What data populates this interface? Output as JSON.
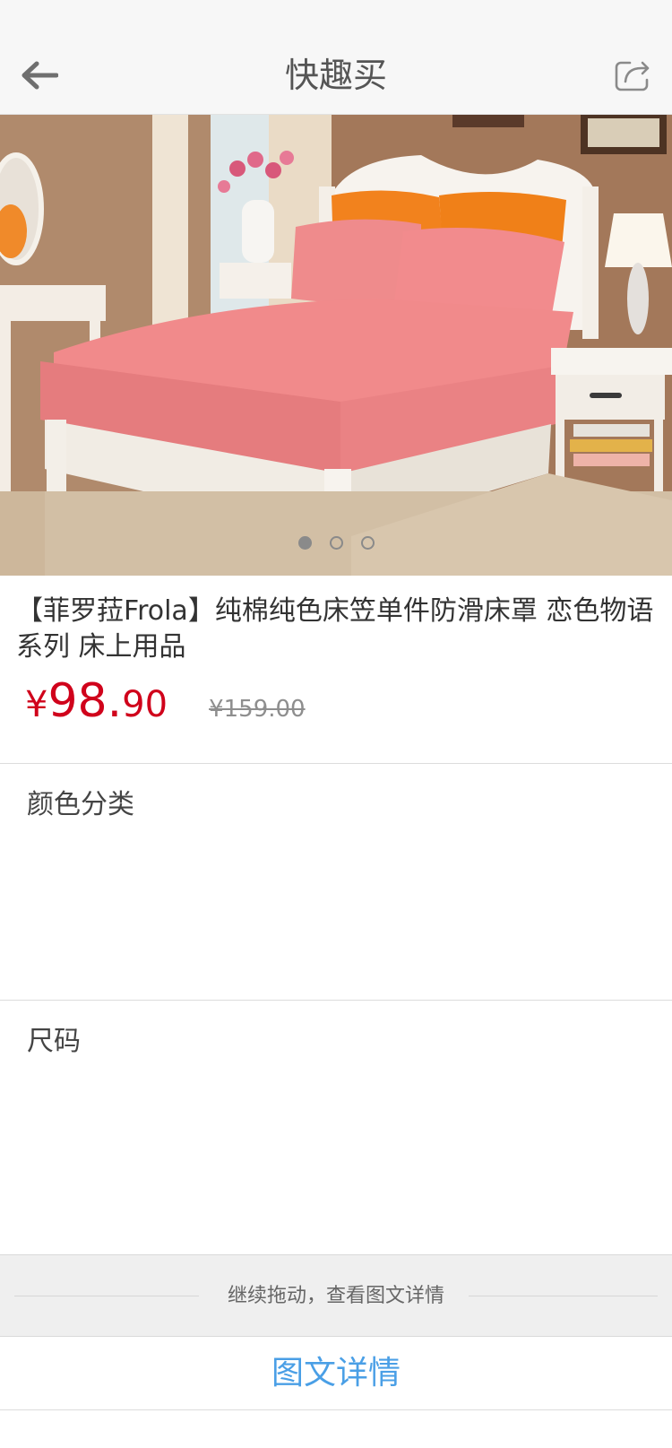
{
  "nav": {
    "title": "快趣买",
    "back_icon": "arrow-left-icon",
    "share_icon": "share-icon"
  },
  "gallery": {
    "image_count": 3,
    "active_index": 0
  },
  "product": {
    "title": "【菲罗菈Frola】纯棉纯色床笠单件防滑床罩 恋色物语系列  床上用品",
    "price_currency": "¥",
    "price_integer": "98.",
    "price_decimal": "90",
    "original_price": "¥159.00"
  },
  "options": {
    "color_label": "颜色分类",
    "size_label": "尺码"
  },
  "footer": {
    "drag_hint": "继续拖动，查看图文详情",
    "detail_label": "图文详情"
  },
  "colors": {
    "price_red": "#d0021b",
    "link_blue": "#4a9fe6",
    "nav_bg": "#f7f7f7"
  }
}
